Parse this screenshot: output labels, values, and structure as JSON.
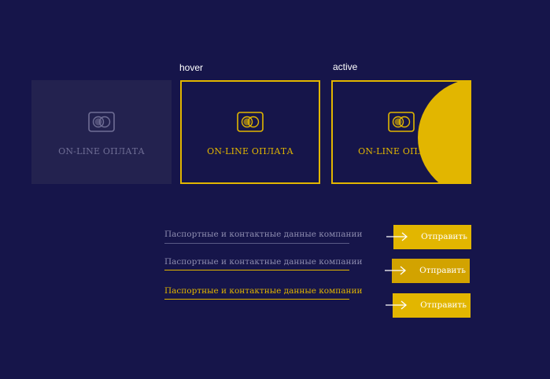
{
  "states": {
    "hover": "hover",
    "active": "active"
  },
  "cards": {
    "default": {
      "label": "ON-LINE ОПЛАТА",
      "icon": "card-circles-icon"
    },
    "hover": {
      "label": "ON-LINE ОПЛАТА",
      "icon": "card-circles-icon"
    },
    "active": {
      "label": "ON-LINE ОПЛАТА",
      "icon": "card-circles-icon"
    }
  },
  "fields": [
    {
      "label": "Паспортные и контактные данные компании",
      "state": "default"
    },
    {
      "label": "Паспортные и контактные данные компании",
      "state": "hover"
    },
    {
      "label": "Паспортные и контактные данные компании",
      "state": "active"
    }
  ],
  "buttons": [
    {
      "label": "Отправить",
      "icon": "arrow-right-icon"
    },
    {
      "label": "Отправить",
      "icon": "arrow-right-icon"
    },
    {
      "label": "Отправить",
      "icon": "arrow-right-icon"
    }
  ],
  "colors": {
    "background": "#16154a",
    "card_default_bg": "#23224f",
    "accent": "#e2b600",
    "accent_dark": "#d2a300",
    "muted_text": "#8e8db0"
  }
}
